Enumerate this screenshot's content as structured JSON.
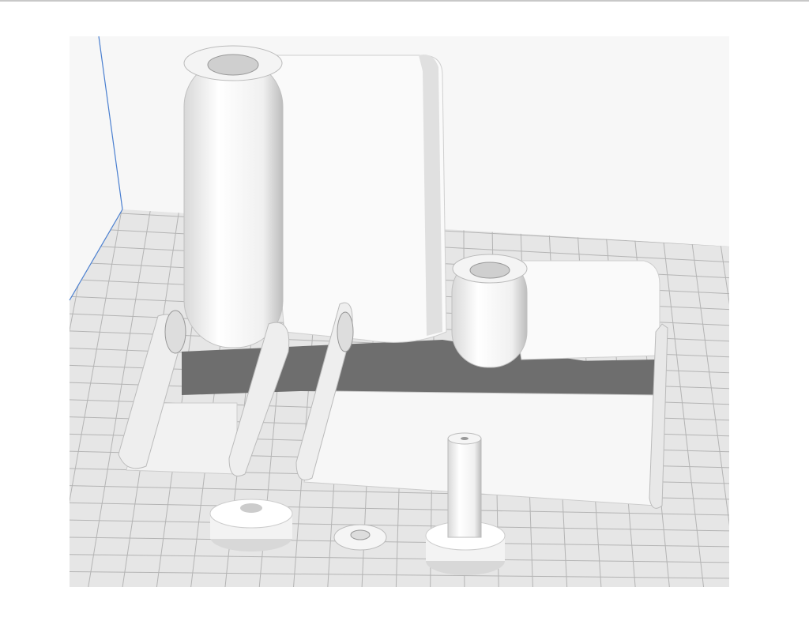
{
  "viewport": {
    "background_color": "#f7f7f7",
    "plate_color": "#e4e4e4",
    "grid_color": "#b4b4b4",
    "axis_color": "#4a7fd0",
    "model_color": "#ffffff",
    "shadow_color": "#6e6e6e"
  }
}
